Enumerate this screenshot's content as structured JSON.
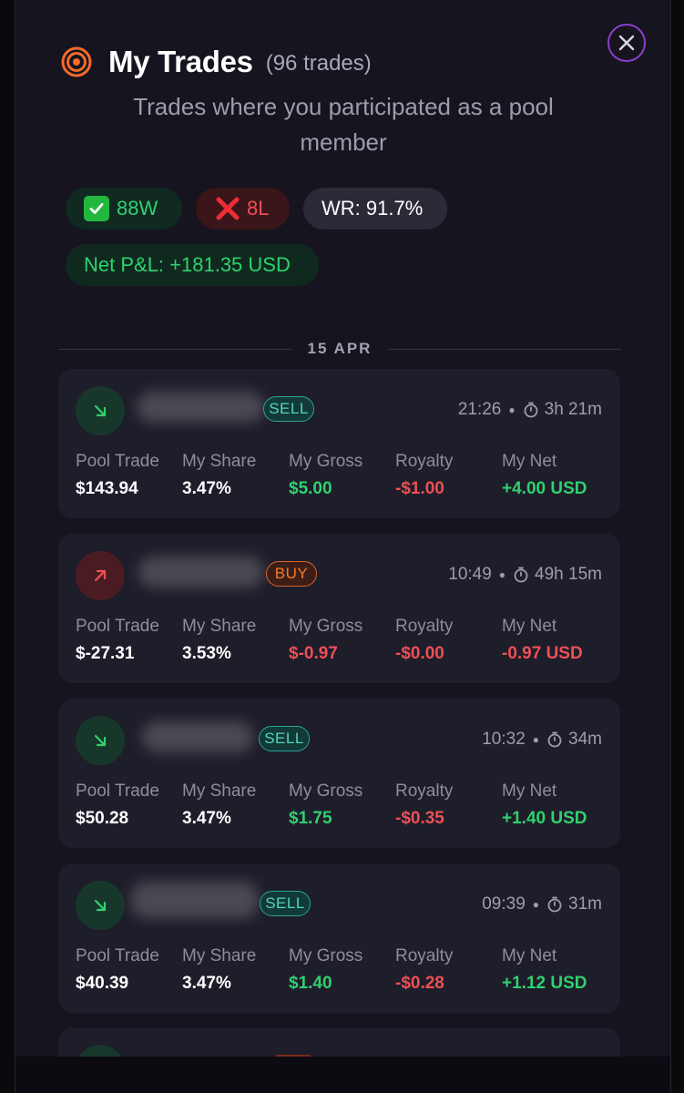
{
  "header": {
    "title": "My Trades",
    "count": "(96 trades)",
    "subtitle": "Trades where you participated as a pool member"
  },
  "stats": {
    "wins": "88W",
    "losses": "8L",
    "win_rate": "WR: 91.7%",
    "net_pnl": "Net P&L: +181.35 USD"
  },
  "date_group": "15 APR",
  "columns": [
    "Pool Trade",
    "My Share",
    "My Gross",
    "Royalty",
    "My Net"
  ],
  "trades": [
    {
      "direction": "sell",
      "side": "SELL",
      "time": "21:26",
      "duration": "3h 21m",
      "pool_trade": "$143.94",
      "my_share": "3.47%",
      "my_gross": "$5.00",
      "royalty": "-$1.00",
      "my_net": "+4.00 USD"
    },
    {
      "direction": "buy",
      "side": "BUY",
      "time": "10:49",
      "duration": "49h 15m",
      "pool_trade": "$-27.31",
      "my_share": "3.53%",
      "my_gross": "$-0.97",
      "royalty": "-$0.00",
      "my_net": "-0.97 USD"
    },
    {
      "direction": "sell",
      "side": "SELL",
      "time": "10:32",
      "duration": "34m",
      "pool_trade": "$50.28",
      "my_share": "3.47%",
      "my_gross": "$1.75",
      "royalty": "-$0.35",
      "my_net": "+1.40 USD"
    },
    {
      "direction": "sell",
      "side": "SELL",
      "time": "09:39",
      "duration": "31m",
      "pool_trade": "$40.39",
      "my_share": "3.47%",
      "my_gross": "$1.40",
      "royalty": "-$0.28",
      "my_net": "+1.12 USD"
    }
  ],
  "colors": {
    "background": "#15141f",
    "card": "#1e1d2a",
    "positive": "#2fd16f",
    "negative": "#ef4f55",
    "sell_badge": "#53d3c2",
    "buy_badge": "#f27a2e",
    "accent_close": "#8b3fc9",
    "target_icon": "#f26b2a"
  },
  "icons": {
    "title": "target-icon",
    "close": "close-icon",
    "sell": "arrow-down-right-icon",
    "buy": "arrow-up-right-icon",
    "timer": "stopwatch-icon",
    "win": "check-icon",
    "loss": "cross-icon"
  }
}
